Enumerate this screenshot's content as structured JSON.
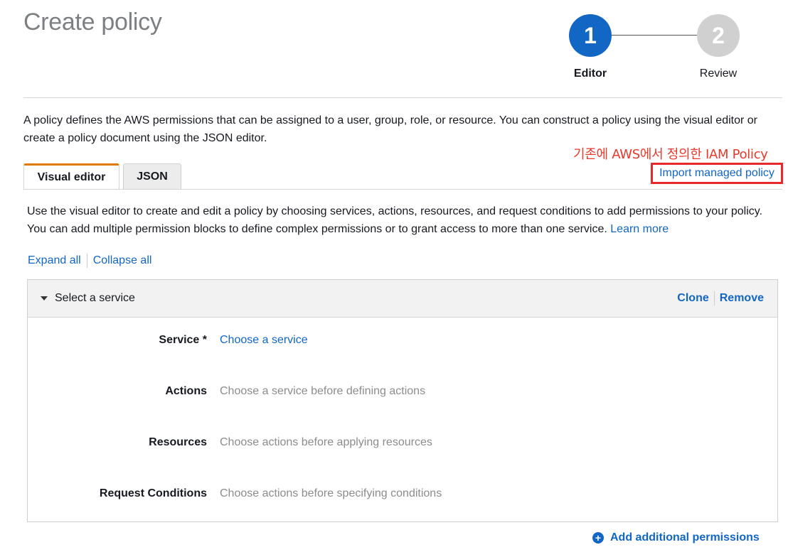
{
  "page": {
    "title": "Create policy"
  },
  "stepper": {
    "steps": [
      {
        "number": "1",
        "label": "Editor",
        "active": true
      },
      {
        "number": "2",
        "label": "Review",
        "active": false
      }
    ]
  },
  "intro_text": "A policy defines the AWS permissions that can be assigned to a user, group, role, or resource. You can construct a policy using the visual editor or create a policy document using the JSON editor.",
  "annotation": "기존에 AWS에서 정의한 IAM Policy",
  "import_link": "Import managed policy",
  "tabs": [
    {
      "label": "Visual editor",
      "active": true
    },
    {
      "label": "JSON",
      "active": false
    }
  ],
  "visual_editor": {
    "description": "Use the visual editor to create and edit a policy by choosing services, actions, resources, and request conditions to add permissions to your policy. You can add multiple permission blocks to define complex permissions or to grant access to more than one service.",
    "learn_more": "Learn more",
    "expand_all": "Expand all",
    "collapse_all": "Collapse all"
  },
  "permission_block": {
    "title": "Select a service",
    "clone": "Clone",
    "remove": "Remove",
    "rows": [
      {
        "label": "Service *",
        "value": "Choose a service",
        "is_link": true
      },
      {
        "label": "Actions",
        "value": "Choose a service before defining actions",
        "is_link": false
      },
      {
        "label": "Resources",
        "value": "Choose actions before applying resources",
        "is_link": false
      },
      {
        "label": "Request Conditions",
        "value": "Choose actions before specifying conditions",
        "is_link": false
      }
    ]
  },
  "add_permissions": "Add additional permissions",
  "colors": {
    "link": "#1266c4",
    "step_active": "#1266c4",
    "step_inactive": "#d0d0d0",
    "tab_accent": "#e07b00",
    "annotation": "#e8392b"
  }
}
